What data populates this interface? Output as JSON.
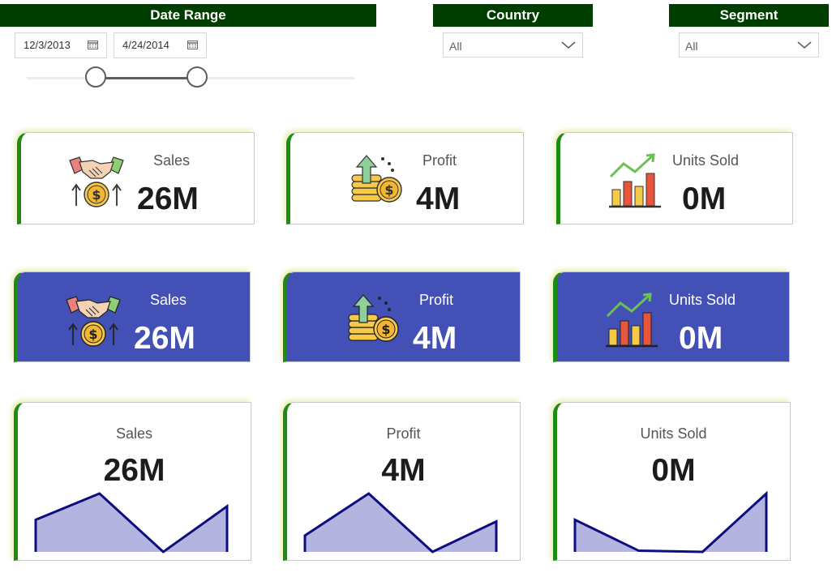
{
  "filters": {
    "date_range": {
      "header": "Date Range",
      "start": "12/3/2013",
      "end": "4/24/2014",
      "slider_start_fraction": 0.21,
      "slider_end_fraction": 0.52
    },
    "country": {
      "header": "Country",
      "selected": "All"
    },
    "segment": {
      "header": "Segment",
      "selected": "All"
    }
  },
  "colors": {
    "header_bg": "#003e00",
    "accent_border": "#1e8c12",
    "card_blue": "#4350b5",
    "spark_fill": "#b3b5e0",
    "spark_line": "#0d0d80"
  },
  "rows": {
    "white_icon_cards": [
      {
        "title": "Sales",
        "value": "26M",
        "icon": "handshake-coin-icon"
      },
      {
        "title": "Profit",
        "value": "4M",
        "icon": "coin-stack-arrow-icon"
      },
      {
        "title": "Units Sold",
        "value": "0M",
        "icon": "bar-chart-growth-icon"
      }
    ],
    "blue_icon_cards": [
      {
        "title": "Sales",
        "value": "26M",
        "icon": "handshake-coin-icon"
      },
      {
        "title": "Profit",
        "value": "4M",
        "icon": "coin-stack-arrow-icon"
      },
      {
        "title": "Units Sold",
        "value": "0M",
        "icon": "bar-chart-growth-icon"
      }
    ],
    "sparkline_cards": [
      {
        "title": "Sales",
        "value": "26M",
        "trend": [
          0.55,
          1.0,
          0.0,
          0.78
        ]
      },
      {
        "title": "Profit",
        "value": "4M",
        "trend": [
          0.28,
          1.0,
          0.0,
          0.52
        ]
      },
      {
        "title": "Units Sold",
        "value": "0M",
        "trend": [
          0.55,
          0.02,
          0.0,
          1.0
        ]
      }
    ]
  }
}
